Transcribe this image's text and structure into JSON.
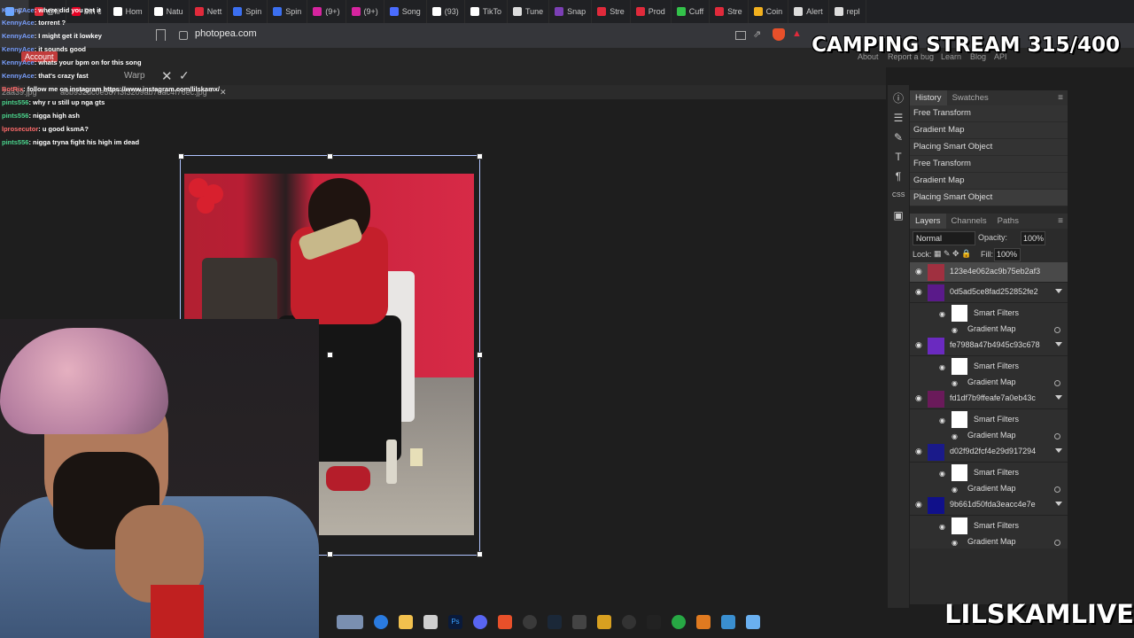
{
  "browser": {
    "tabs": [
      {
        "label": "F",
        "color": "#6aa8ff",
        "active": true
      },
      {
        "label": "@lil",
        "color": "#e02a3b"
      },
      {
        "label": "Pin c",
        "color": "#e60023"
      },
      {
        "label": "Hom",
        "color": "#ffffff"
      },
      {
        "label": "Natu",
        "color": "#ffffff"
      },
      {
        "label": "Nett",
        "color": "#e02a3b"
      },
      {
        "label": "Spin",
        "color": "#3b6ff0"
      },
      {
        "label": "Spin",
        "color": "#3b6ff0"
      },
      {
        "label": "(9+)",
        "color": "#d6249f"
      },
      {
        "label": "(9+)",
        "color": "#d6249f"
      },
      {
        "label": "Song",
        "color": "#4a6cff"
      },
      {
        "label": "(93)",
        "color": "#ffffff"
      },
      {
        "label": "TikTo",
        "color": "#ffffff"
      },
      {
        "label": "Tune",
        "color": "#dddddd"
      },
      {
        "label": "Snap",
        "color": "#7b3fb5"
      },
      {
        "label": "Stre",
        "color": "#e02a3b"
      },
      {
        "label": "Prod",
        "color": "#e02a3b"
      },
      {
        "label": "Cuff",
        "color": "#33c24a"
      },
      {
        "label": "Stre",
        "color": "#e02a3b"
      },
      {
        "label": "Coin",
        "color": "#f2b01e"
      },
      {
        "label": "Alert",
        "color": "#dddddd"
      },
      {
        "label": "repl",
        "color": "#dddddd"
      }
    ],
    "url": "photopea.com"
  },
  "menu": {
    "account": "Account",
    "about": "About",
    "report": "Report a bug",
    "learn": "Learn",
    "blog": "Blog",
    "api": "API"
  },
  "options": {
    "warp": "Warp"
  },
  "doc_tabs": [
    "2aa39.jpg",
    "a8b932dc0e587f3f3209ab7dac4f76ec.jpg *"
  ],
  "chat": [
    {
      "user": "KennyAce",
      "msg": ": where did you get it",
      "color": "#7aa0ff"
    },
    {
      "user": "KennyAce",
      "msg": ": torrent ?",
      "color": "#7aa0ff"
    },
    {
      "user": "KennyAce",
      "msg": ": I might get it lowkey",
      "color": "#7aa0ff"
    },
    {
      "user": "KennyAce",
      "msg": ": it sounds good",
      "color": "#7aa0ff"
    },
    {
      "user": "KennyAce",
      "msg": ": whats your bpm on for this song",
      "color": "#7aa0ff"
    },
    {
      "user": "KennyAce",
      "msg": ": that's crazy fast",
      "color": "#7aa0ff"
    },
    {
      "user": "BotRix",
      "msg": ": follow me on instagram https://www.instagram.com/lilskamx/",
      "color": "#ff6b6b"
    },
    {
      "user": "pints556",
      "msg": ": why r u still up nga gts",
      "color": "#4ad48c"
    },
    {
      "user": "pints556",
      "msg": ": nigga high ash",
      "color": "#4ad48c"
    },
    {
      "user": "lprosecutor",
      "msg": ": u good ksmA?",
      "color": "#ff6b6b"
    },
    {
      "user": "pints556",
      "msg": ": nigga tryna fight his high im dead",
      "color": "#4ad48c"
    }
  ],
  "overlay": {
    "title": "CAMPING STREAM 315/400",
    "brand": "LILSKAMLIVE"
  },
  "history": {
    "tabs": [
      "History",
      "Swatches"
    ],
    "items": [
      "Free Transform",
      "Gradient Map",
      "Placing Smart Object",
      "Free Transform",
      "Gradient Map",
      "Placing Smart Object"
    ]
  },
  "layers_panel": {
    "tabs": [
      "Layers",
      "Channels",
      "Paths"
    ],
    "blend_mode": "Normal",
    "opacity_label": "Opacity:",
    "opacity": "100%",
    "lock_label": "Lock:",
    "fill_label": "Fill:",
    "fill": "100%",
    "smart_filters_label": "Smart Filters",
    "gradient_map_label": "Gradient Map",
    "layers": [
      {
        "name": "123e4e062ac9b75eb2af3",
        "thumb": "#a03040",
        "selected": true,
        "has_filters": false
      },
      {
        "name": "0d5ad5ce8fad252852fe2",
        "thumb": "#5a1a8a",
        "has_filters": true
      },
      {
        "name": "fe7988a47b4945c93c678",
        "thumb": "#6a2ac0",
        "has_filters": true
      },
      {
        "name": "fd1df7b9ffeafe7a0eb43c",
        "thumb": "#6a1a5a",
        "has_filters": true
      },
      {
        "name": "d02f9d2fcf4e29d917294",
        "thumb": "#1a1a8a",
        "has_filters": true
      },
      {
        "name": "9b661d50fda3eacc4e7e",
        "thumb": "#10108a",
        "has_filters": true
      }
    ]
  }
}
